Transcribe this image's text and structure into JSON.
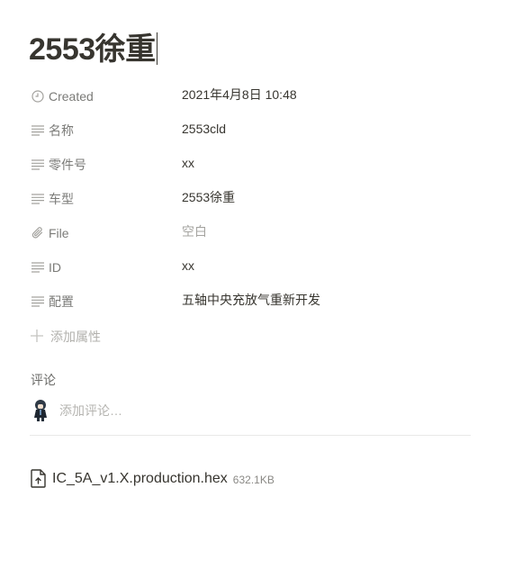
{
  "page": {
    "title": "2553徐重"
  },
  "properties": [
    {
      "icon": "clock-icon",
      "key": "Created",
      "value": "2021年4月8日 10:48",
      "empty": false
    },
    {
      "icon": "text-lines-icon",
      "key": "名称",
      "value": "2553cld",
      "empty": false
    },
    {
      "icon": "text-lines-icon",
      "key": "零件号",
      "value": "xx",
      "empty": false
    },
    {
      "icon": "text-lines-icon",
      "key": "车型",
      "value": "2553徐重",
      "empty": false
    },
    {
      "icon": "paperclip-icon",
      "key": "File",
      "value": "空白",
      "empty": true
    },
    {
      "icon": "text-lines-icon",
      "key": "ID",
      "value": "xx",
      "empty": false
    },
    {
      "icon": "text-lines-icon",
      "key": "配置",
      "value": "五轴中央充放气重新开发",
      "empty": false
    }
  ],
  "add_property": {
    "label": "添加属性",
    "icon": "plus-icon"
  },
  "comments": {
    "label": "评论",
    "placeholder": "添加评论…",
    "avatar": "user-avatar"
  },
  "attachment": {
    "icon": "file-upload-icon",
    "name": "IC_5A_v1.X.production.hex",
    "size": "632.1KB"
  }
}
